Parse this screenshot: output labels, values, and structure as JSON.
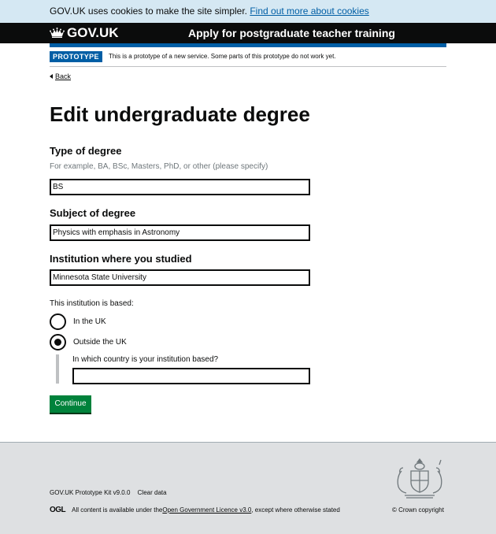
{
  "cookie_banner": {
    "text": "GOV.UK uses cookies to make the site simpler.",
    "link": "Find out more about cookies"
  },
  "header": {
    "logo_text": "GOV.UK",
    "service_name": "Apply for postgraduate teacher training"
  },
  "phase_banner": {
    "tag": "PROTOTYPE",
    "text": "This is a prototype of a new service. Some parts of this prototype do not work yet."
  },
  "back_link": "Back",
  "page_title": "Edit undergraduate degree",
  "form": {
    "type_of_degree": {
      "label": "Type of degree",
      "hint": "For example, BA, BSc, Masters, PhD, or other (please specify)",
      "value": "BS"
    },
    "subject": {
      "label": "Subject of degree",
      "value": "Physics with emphasis in Astronomy"
    },
    "institution": {
      "label": "Institution where you studied",
      "value": "Minnesota State University"
    },
    "location": {
      "label": "This institution is based:",
      "options": [
        {
          "label": "In the UK",
          "checked": false
        },
        {
          "label": "Outside the UK",
          "checked": true
        }
      ],
      "country_label": "In which country is your institution based?",
      "country_value": ""
    },
    "continue_button": "Continue"
  },
  "footer": {
    "links": [
      "GOV.UK Prototype Kit v9.0.0",
      "Clear data"
    ],
    "ogl_logo": "OGL",
    "licence_prefix": "All content is available under the ",
    "licence_link": "Open Government Licence v3.0",
    "licence_suffix": ", except where otherwise stated",
    "copyright": "© Crown copyright"
  },
  "colors": {
    "brand_blue": "#005ea5",
    "button_green": "#00823b",
    "header_black": "#0b0c0c",
    "cookie_bg": "#d5e8f3",
    "footer_bg": "#dee0e2"
  }
}
